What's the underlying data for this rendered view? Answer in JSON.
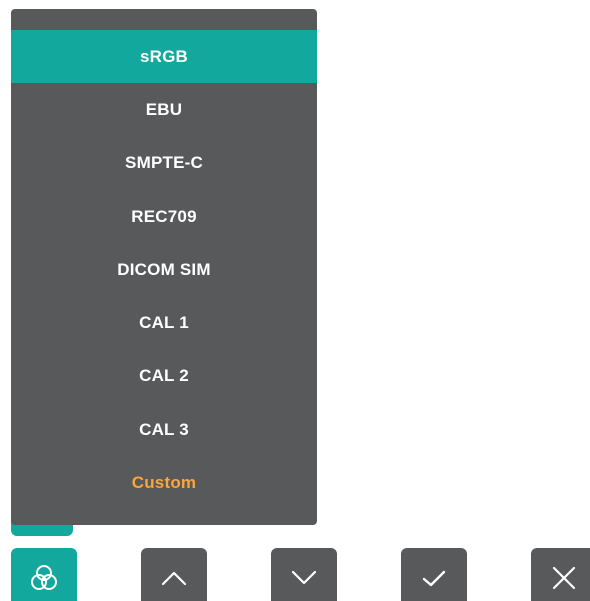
{
  "menu": {
    "items": [
      {
        "label": "sRGB",
        "selected": true
      },
      {
        "label": "EBU"
      },
      {
        "label": "SMPTE-C"
      },
      {
        "label": "REC709"
      },
      {
        "label": "DICOM SIM"
      },
      {
        "label": "CAL 1"
      },
      {
        "label": "CAL 2"
      },
      {
        "label": "CAL 3"
      },
      {
        "label": "Custom",
        "highlight": true
      }
    ]
  },
  "buttons": [
    {
      "icon": "color-circles-icon"
    },
    {
      "icon": "chevron-up-icon"
    },
    {
      "icon": "chevron-down-icon"
    },
    {
      "icon": "checkmark-icon"
    },
    {
      "icon": "close-icon"
    }
  ],
  "colors": {
    "panel": "#58595b",
    "accent": "#13a89e",
    "custom": "#f9a63a",
    "text": "#ffffff"
  }
}
